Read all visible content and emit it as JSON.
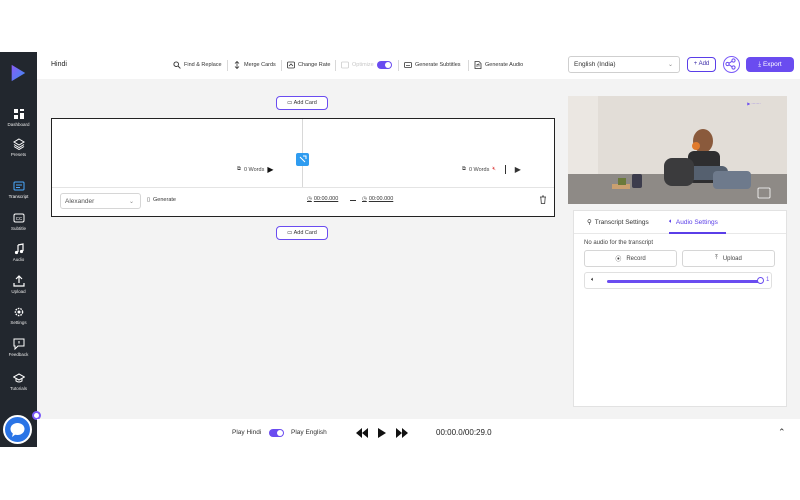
{
  "sidebar": {
    "items": [
      {
        "label": "Dashboard",
        "icon": "dashboard-icon"
      },
      {
        "label": "Presets",
        "icon": "layers-icon"
      },
      {
        "label": "Transcript",
        "icon": "transcript-icon"
      },
      {
        "label": "Subtitle",
        "icon": "subtitle-icon"
      },
      {
        "label": "Audio",
        "icon": "music-icon"
      },
      {
        "label": "Upload",
        "icon": "upload-icon"
      },
      {
        "label": "Settings",
        "icon": "gear-icon"
      },
      {
        "label": "Feedback",
        "icon": "feedback-icon"
      },
      {
        "label": "Tutorials",
        "icon": "graduation-cap-icon"
      }
    ]
  },
  "topbar": {
    "language": "Hindi",
    "find_replace": "Find & Replace",
    "merge_cards": "Merge Cards",
    "change_rate": "Change Rate",
    "optimize": "Optimize",
    "generate_subtitles": "Generate Subtitles",
    "generate_audio": "Generate Audio",
    "language_select": "English (India)",
    "add": "+ Add",
    "export": "Export"
  },
  "editor": {
    "add_card": "Add Card",
    "left_words": "0 Words",
    "right_words": "0 Words",
    "speaker": "Alexander",
    "generate": "Generate",
    "start_time": "00:00.000",
    "end_time": "00:00.000"
  },
  "panel": {
    "tab_transcript": "Transcript Settings",
    "tab_audio": "Audio Settings",
    "no_audio": "No audio for the transcript",
    "record": "Record",
    "upload": "Upload",
    "volume": "1"
  },
  "bottom": {
    "play_hindi": "Play Hindi",
    "play_english": "Play English",
    "time": "00:00.0/00:29.0"
  },
  "colors": {
    "accent": "#6a4cf0",
    "sidebar": "#22272e",
    "merge_chip": "#2f9cf0"
  }
}
